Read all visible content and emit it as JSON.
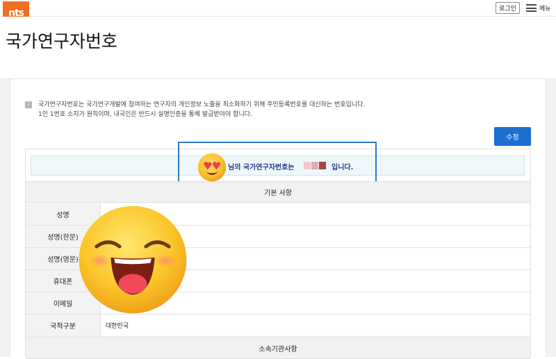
{
  "header": {
    "logo_text": "nts",
    "login_label": "로그인",
    "menu_label": "메뉴"
  },
  "page": {
    "title": "국가연구자번호"
  },
  "notice": {
    "icon": "i",
    "line1": "국가연구자번호는 국가연구개발에 참여하는 연구자의 개인정보 노출을 최소화하기 위해 주민등록번호를 대신하는 번호입니다.",
    "line2": "1인 1번호 소지가 원칙이며, 내국인은 반드시 실명인증을 통해 발급받아야 합니다."
  },
  "edit_button_label": "수정",
  "id_banner": {
    "prefix": "님의 국가연구자번호는",
    "suffix": "입니다."
  },
  "sections": {
    "basic": "기본 사항",
    "org": "소속기관사항"
  },
  "rows": [
    {
      "label": "성명",
      "value": ""
    },
    {
      "label": "성명(한문)",
      "value": ""
    },
    {
      "label": "성명(영문)",
      "value": ""
    },
    {
      "label": "휴대폰",
      "value": ""
    },
    {
      "label": "이메일",
      "value": ""
    },
    {
      "label": "국적구분",
      "value": "대한민국"
    }
  ],
  "colors": {
    "brand_orange": "#f26f21",
    "accent_blue": "#1a6fd1",
    "banner_text": "#1d3a8a"
  }
}
